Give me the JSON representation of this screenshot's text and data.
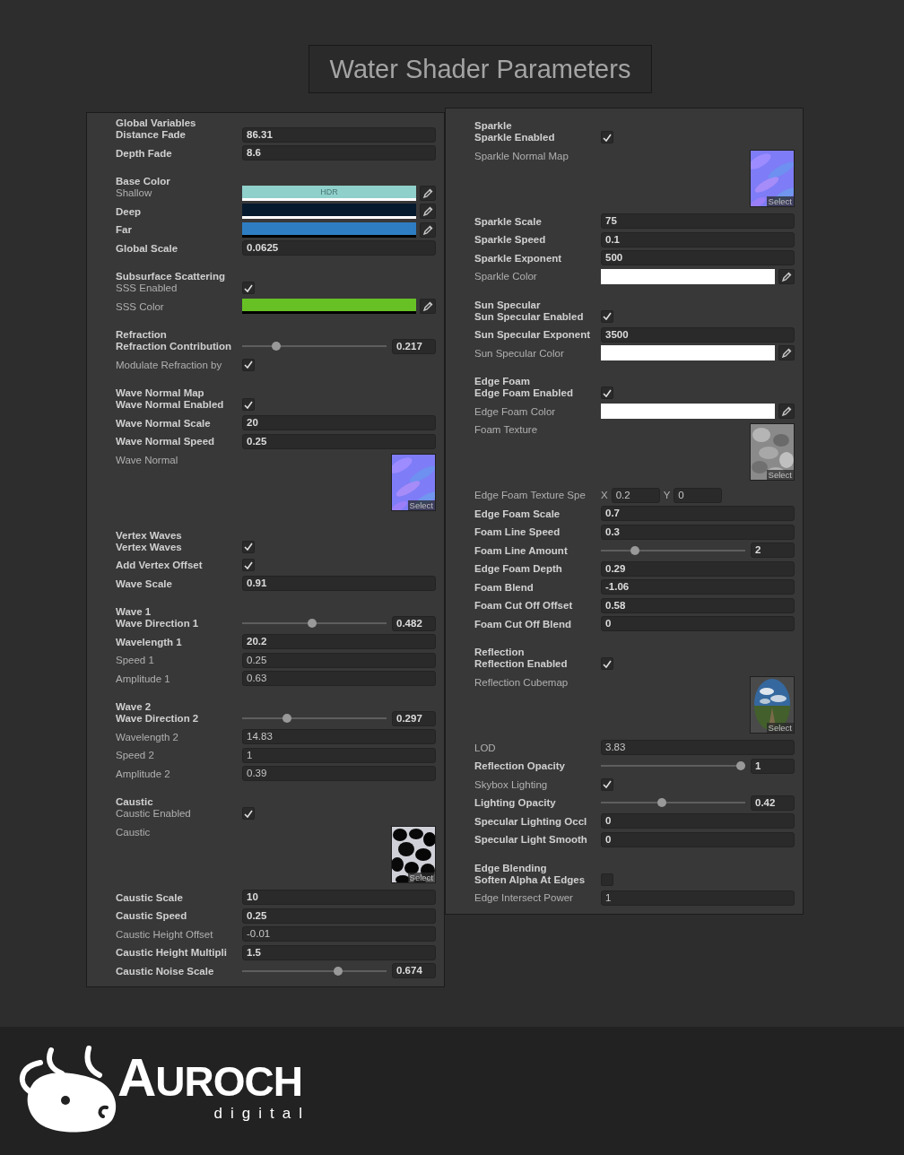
{
  "title": "Water Shader Parameters",
  "panels": [
    {
      "sections": [
        {
          "header": "Global Variables",
          "rows": [
            {
              "label": "Distance Fade",
              "bold": true,
              "kind": "float",
              "value": "86.31"
            },
            {
              "label": "Depth Fade",
              "bold": true,
              "kind": "float",
              "value": "8.6"
            }
          ]
        },
        {
          "header": "Base Color",
          "rows": [
            {
              "label": "Shallow",
              "bold": false,
              "kind": "color",
              "color": "#8fd0cb",
              "level": 1,
              "badge": "HDR"
            },
            {
              "label": "Deep",
              "bold": true,
              "kind": "color",
              "color": "#061a2e",
              "level": 1
            },
            {
              "label": "Far",
              "bold": true,
              "kind": "color",
              "color": "#2e7dc2",
              "level": 0
            },
            {
              "label": "Global Scale",
              "bold": true,
              "kind": "float",
              "value": "0.0625"
            }
          ]
        },
        {
          "header": "Subsurface Scattering",
          "rows": [
            {
              "label": "SSS Enabled",
              "bold": false,
              "kind": "toggle",
              "checked": true
            },
            {
              "label": "SSS Color",
              "bold": false,
              "kind": "color",
              "color": "#67c125",
              "level": 0
            }
          ]
        },
        {
          "header": "Refraction",
          "rows": [
            {
              "label": "Refraction Contribution",
              "bold": true,
              "kind": "slider",
              "level": 0.217,
              "value": "0.217"
            },
            {
              "label": "Modulate Refraction by",
              "bold": false,
              "kind": "toggle",
              "checked": true
            }
          ]
        },
        {
          "header": "Wave Normal Map",
          "rows": [
            {
              "label": "Wave Normal Enabled",
              "bold": true,
              "kind": "toggle",
              "checked": true
            },
            {
              "label": "Wave Normal Scale",
              "bold": true,
              "kind": "float",
              "value": "20"
            },
            {
              "label": "Wave Normal Speed",
              "bold": true,
              "kind": "float",
              "value": "0.25"
            },
            {
              "label": "Wave Normal",
              "bold": false,
              "kind": "texture",
              "button": "Select"
            }
          ]
        },
        {
          "header": "Vertex Waves",
          "rows": [
            {
              "label": "Vertex Waves",
              "bold": true,
              "kind": "toggle",
              "checked": true
            },
            {
              "label": "Add Vertex Offset",
              "bold": true,
              "kind": "toggle",
              "checked": true
            },
            {
              "label": "Wave Scale",
              "bold": true,
              "kind": "float",
              "value": "0.91"
            }
          ]
        },
        {
          "header": "Wave 1",
          "rows": [
            {
              "label": "Wave Direction 1",
              "bold": true,
              "kind": "slider",
              "level": 0.482,
              "value": "0.482"
            },
            {
              "label": "Wavelength 1",
              "bold": true,
              "kind": "float",
              "value": "20.2"
            },
            {
              "label": "Speed 1",
              "bold": false,
              "kind": "float",
              "value": "0.25"
            },
            {
              "label": "Amplitude 1",
              "bold": false,
              "kind": "float",
              "value": "0.63"
            }
          ]
        },
        {
          "header": "Wave 2",
          "rows": [
            {
              "label": "Wave Direction 2",
              "bold": true,
              "kind": "slider",
              "level": 0.297,
              "value": "0.297"
            },
            {
              "label": "Wavelength 2",
              "bold": false,
              "kind": "float",
              "value": "14.83"
            },
            {
              "label": "Speed 2",
              "bold": false,
              "kind": "float",
              "value": "1"
            },
            {
              "label": "Amplitude 2",
              "bold": false,
              "kind": "float",
              "value": "0.39"
            }
          ]
        },
        {
          "header": "Caustic",
          "rows": [
            {
              "label": "Caustic Enabled",
              "bold": false,
              "kind": "toggle",
              "checked": true
            },
            {
              "label": "Caustic",
              "bold": false,
              "kind": "texture",
              "button": "Select"
            },
            {
              "label": "Caustic Scale",
              "bold": true,
              "kind": "float",
              "value": "10"
            },
            {
              "label": "Caustic Speed",
              "bold": true,
              "kind": "float",
              "value": "0.25"
            },
            {
              "label": "Caustic Height Offset",
              "bold": false,
              "kind": "float",
              "value": "-0.01"
            },
            {
              "label": "Caustic Height Multipli",
              "bold": true,
              "kind": "float",
              "value": "1.5"
            },
            {
              "label": "Caustic Noise Scale",
              "bold": true,
              "kind": "slider",
              "level": 0.674,
              "value": "0.674"
            }
          ]
        }
      ]
    },
    {
      "sections": [
        {
          "header": "Sparkle",
          "rows": [
            {
              "label": "Sparkle Enabled",
              "bold": true,
              "kind": "toggle",
              "checked": true
            },
            {
              "label": "Sparkle Normal Map",
              "bold": false,
              "kind": "texture",
              "button": "Select"
            },
            {
              "label": "Sparkle Scale",
              "bold": true,
              "kind": "float",
              "value": "75"
            },
            {
              "label": "Sparkle Speed",
              "bold": true,
              "kind": "float",
              "value": "0.1"
            },
            {
              "label": "Sparkle Exponent",
              "bold": true,
              "kind": "float",
              "value": "500"
            },
            {
              "label": "Sparkle Color",
              "bold": false,
              "kind": "color",
              "color": "#ffffff",
              "level": 1
            }
          ]
        },
        {
          "header": "Sun Specular",
          "rows": [
            {
              "label": "Sun Specular Enabled",
              "bold": true,
              "kind": "toggle",
              "checked": true
            },
            {
              "label": "Sun Specular Exponent",
              "bold": true,
              "kind": "float",
              "value": "3500"
            },
            {
              "label": "Sun Specular Color",
              "bold": false,
              "kind": "color",
              "color": "#ffffff",
              "level": 1
            }
          ]
        },
        {
          "header": "Edge Foam",
          "rows": [
            {
              "label": "Edge Foam Enabled",
              "bold": true,
              "kind": "toggle",
              "checked": true
            },
            {
              "label": "Edge Foam Color",
              "bold": false,
              "kind": "color",
              "color": "#ffffff",
              "level": 1
            },
            {
              "label": "Foam Texture",
              "bold": false,
              "kind": "texture",
              "button": "Select"
            },
            {
              "label": "Edge Foam Texture Spe",
              "bold": false,
              "kind": "vector2",
              "fields": [
                {
                  "axis": "X",
                  "value": "0.2"
                },
                {
                  "axis": "Y",
                  "value": "0"
                }
              ]
            },
            {
              "label": "Edge Foam Scale",
              "bold": true,
              "kind": "float",
              "value": "0.7"
            },
            {
              "label": "Foam Line Speed",
              "bold": true,
              "kind": "float",
              "value": "0.3"
            },
            {
              "label": "Foam Line Amount",
              "bold": true,
              "kind": "slider",
              "level": 0.22,
              "value": "2"
            },
            {
              "label": "Edge Foam Depth",
              "bold": true,
              "kind": "float",
              "value": "0.29"
            },
            {
              "label": "Foam Blend",
              "bold": true,
              "kind": "float",
              "value": "-1.06"
            },
            {
              "label": "Foam Cut Off Offset",
              "bold": true,
              "kind": "float",
              "value": "0.58"
            },
            {
              "label": "Foam Cut Off Blend",
              "bold": true,
              "kind": "float",
              "value": "0"
            }
          ]
        },
        {
          "header": "Reflection",
          "rows": [
            {
              "label": "Reflection Enabled",
              "bold": true,
              "kind": "toggle",
              "checked": true
            },
            {
              "label": "Reflection Cubemap",
              "bold": false,
              "kind": "texture",
              "button": "Select"
            },
            {
              "label": "LOD",
              "bold": false,
              "kind": "float",
              "value": "3.83"
            },
            {
              "label": "Reflection Opacity",
              "bold": true,
              "kind": "slider",
              "level": 1,
              "value": "1"
            },
            {
              "label": "Skybox Lighting",
              "bold": false,
              "kind": "toggle",
              "checked": true
            },
            {
              "label": "Lighting Opacity",
              "bold": true,
              "kind": "slider",
              "level": 0.42,
              "value": "0.42"
            },
            {
              "label": "Specular Lighting Occl",
              "bold": true,
              "kind": "float",
              "value": "0"
            },
            {
              "label": "Specular Light Smooth",
              "bold": true,
              "kind": "float",
              "value": "0"
            }
          ]
        },
        {
          "header": "Edge Blending",
          "rows": [
            {
              "label": "Soften Alpha At Edges",
              "bold": true,
              "kind": "toggle",
              "checked": false
            },
            {
              "label": "Edge Intersect Power",
              "bold": false,
              "kind": "float",
              "value": "1"
            }
          ]
        }
      ]
    }
  ],
  "logo": {
    "name": "AUROCH",
    "tagline": "digital"
  }
}
